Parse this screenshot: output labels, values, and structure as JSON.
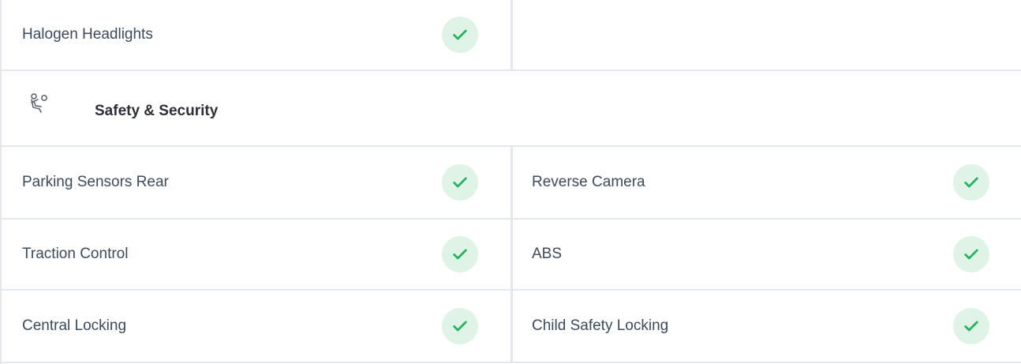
{
  "colors": {
    "border": "#e3e8ee",
    "check_bg": "#dff4e6",
    "check_fg": "#1fb45a",
    "text": "#3c4a5c",
    "title": "#2b2f36"
  },
  "top_row": {
    "left_label": "Halogen Headlights"
  },
  "section": {
    "icon": "seatbelt-person-icon",
    "title": "Safety & Security"
  },
  "features": [
    {
      "left": "Parking Sensors Rear",
      "right": "Reverse Camera"
    },
    {
      "left": "Traction Control",
      "right": "ABS"
    },
    {
      "left": "Central Locking",
      "right": "Child Safety Locking"
    }
  ]
}
